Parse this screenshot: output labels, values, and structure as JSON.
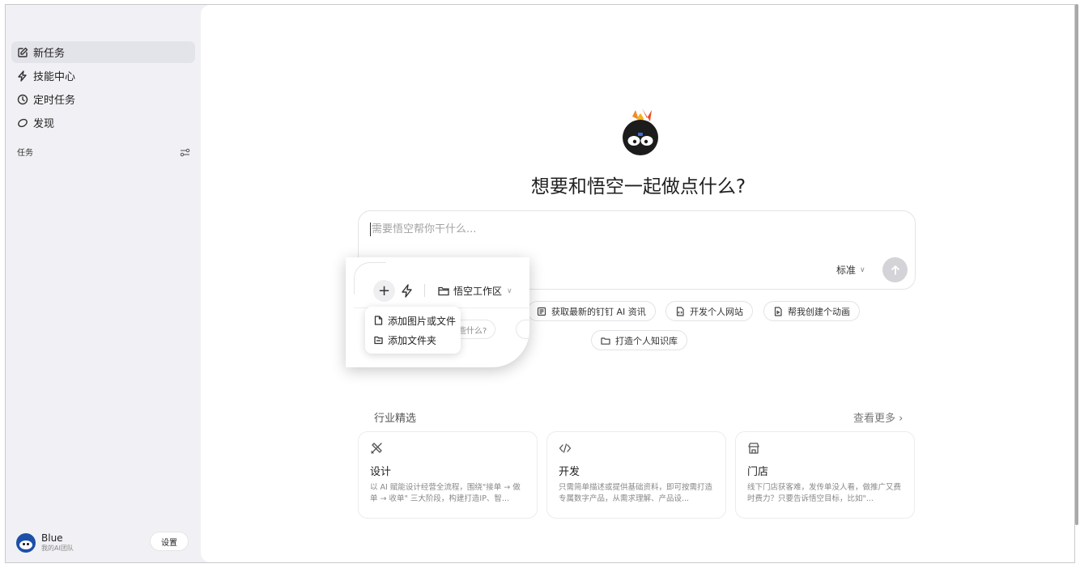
{
  "sidebar": {
    "nav": [
      {
        "label": "新任务",
        "icon": "edit-icon",
        "active": true
      },
      {
        "label": "技能中心",
        "icon": "bolt-icon",
        "active": false
      },
      {
        "label": "定时任务",
        "icon": "clock-icon",
        "active": false
      },
      {
        "label": "发现",
        "icon": "discover-icon",
        "active": false
      }
    ],
    "section_title": "任务",
    "user": {
      "name": "Blue",
      "subtitle": "我的AI团队"
    },
    "settings_label": "设置"
  },
  "main": {
    "headline": "想要和悟空一起做点什么?",
    "composer": {
      "placeholder": "需要悟空帮你干什么...",
      "mode": "标准",
      "workspace": "悟空工作区",
      "add_menu": [
        "添加图片或文件",
        "添加文件夹"
      ]
    },
    "suggestions": [
      {
        "label": "获取最新的钉钉 AI 资讯",
        "icon": "news-icon"
      },
      {
        "label": "开发个人网站",
        "icon": "code-file-icon"
      },
      {
        "label": "帮我创建个动画",
        "icon": "animation-file-icon"
      },
      {
        "label": "打造个人知识库",
        "icon": "folder-icon"
      }
    ],
    "ghost_chip": "做些什么?",
    "industry": {
      "title": "行业精选",
      "more": "查看更多 ›",
      "cards": [
        {
          "title": "设计",
          "desc": "以 AI 赋能设计经营全流程，围绕\"接单 → 做单 → 收单\" 三大阶段，构建打造IP、智...",
          "icon": "design-icon"
        },
        {
          "title": "开发",
          "desc": "只需简单描述或提供基础资料，即可按需打造专属数字产品，从需求理解、产品设...",
          "icon": "code-icon"
        },
        {
          "title": "门店",
          "desc": "线下门店获客难，发传单没人看，做推广又费时费力？只要告诉悟空目标，比如\"...",
          "icon": "store-icon"
        }
      ]
    }
  },
  "colors": {
    "sidebar_bg": "#f1f1f5",
    "active_nav": "#e3e3ea",
    "send_btn": "#d4d4d8"
  }
}
